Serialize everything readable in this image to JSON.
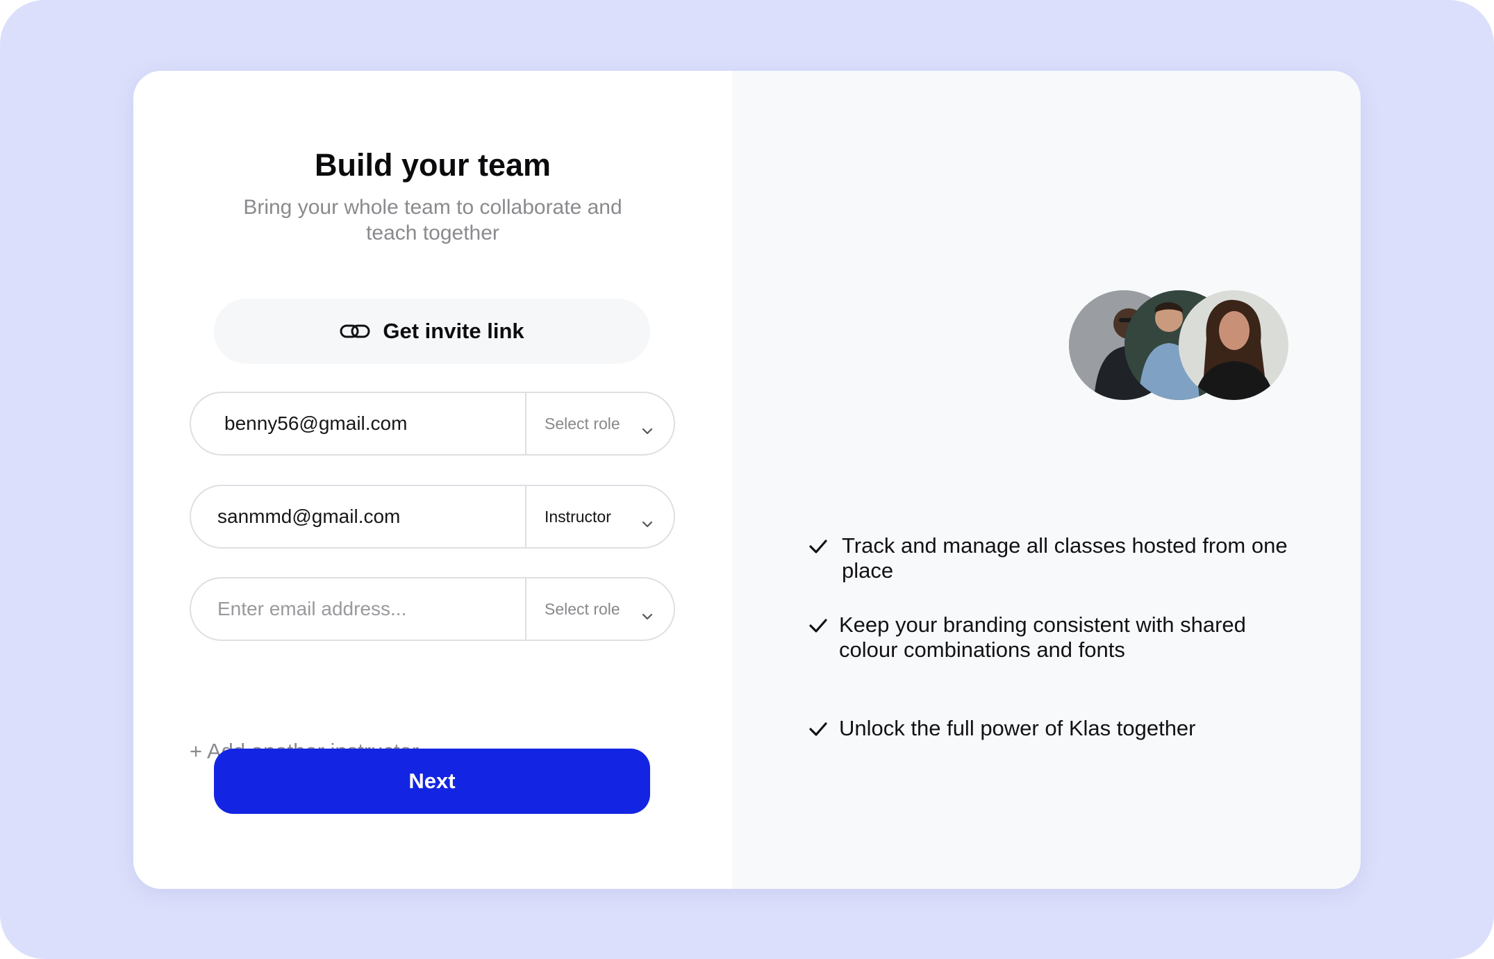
{
  "header": {
    "title": "Build your team",
    "subtitle": "Bring your whole team to collaborate and teach together"
  },
  "invite": {
    "label": "Get invite link",
    "icon": "link-icon"
  },
  "invitees": [
    {
      "email": "benny56@gmail.com",
      "role": "Select role",
      "role_selected": false
    },
    {
      "email": "sanmmd@gmail.com",
      "role": "Instructor",
      "role_selected": true
    },
    {
      "placeholder": "Enter email address...",
      "role": "Select role",
      "role_selected": false
    }
  ],
  "add_another": "+ Add another instructor",
  "next_label": "Next",
  "features": [
    "Track and manage all classes hosted from one place",
    "Keep your branding consistent with shared colour combinations and fonts",
    "Unlock the full power of Klas together"
  ],
  "colors": {
    "outer_background": "#dcdffb",
    "card_background": "#ffffff",
    "right_panel_background": "#f8f9fb",
    "primary_button": "#1325e3",
    "muted_text": "#8a8a8e",
    "border": "#dedfe3"
  },
  "icons": {
    "chevron": "chevron-down-icon",
    "check": "check-icon"
  }
}
